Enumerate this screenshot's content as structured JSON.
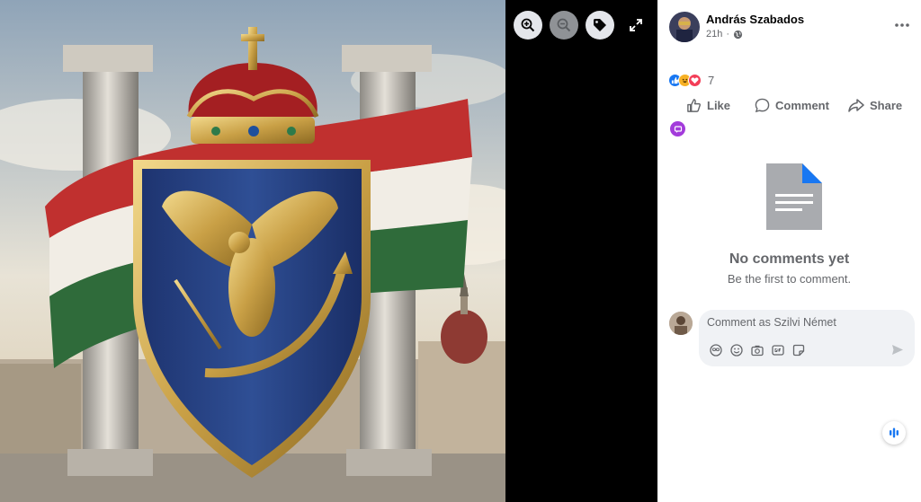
{
  "post": {
    "author": "András Szabados",
    "time": "21h",
    "privacy_icon": "globe-icon"
  },
  "reactions": {
    "types": [
      "like",
      "haha",
      "love"
    ],
    "count": "7"
  },
  "actions": {
    "like": "Like",
    "comment": "Comment",
    "share": "Share"
  },
  "comments": {
    "empty_title": "No comments yet",
    "empty_subtitle": "Be the first to comment.",
    "input_placeholder": "Comment as Szilvi Német",
    "toolbar_icons": [
      "avatar-sticker-icon",
      "emoji-icon",
      "camera-icon",
      "gif-icon",
      "sticker-icon"
    ]
  },
  "viewer": {
    "tools": [
      "zoom-in-icon",
      "zoom-out-icon",
      "tag-icon",
      "fullscreen-icon"
    ]
  },
  "colors": {
    "accent": "#1877f2",
    "text_secondary": "#65676b",
    "flag_red": "#c0302f",
    "flag_green": "#2f6b3a",
    "shield_blue": "#233f82",
    "gold": "#c9a046"
  }
}
